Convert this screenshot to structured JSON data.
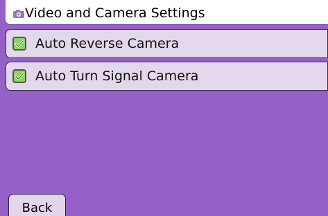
{
  "header": {
    "title": "Video and Camera Settings",
    "icon": "camera-icon"
  },
  "settings": [
    {
      "label": "Auto Reverse Camera",
      "checked": true
    },
    {
      "label": "Auto Turn Signal Camera",
      "checked": true
    }
  ],
  "footer": {
    "back_label": "Back"
  },
  "colors": {
    "background": "#9560c8",
    "row_background": "#e3d7ec",
    "check_green": "#8bd35e"
  }
}
